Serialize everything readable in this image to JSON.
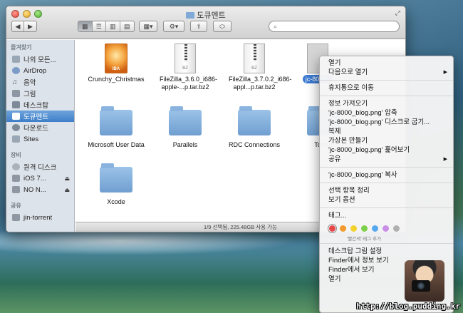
{
  "window": {
    "title": "도큐멘트"
  },
  "search": {
    "placeholder": ""
  },
  "sidebar": {
    "sections": [
      {
        "header": "즐겨찾기",
        "items": [
          "나의 모든...",
          "AirDrop",
          "음악",
          "그림",
          "데스크탑",
          "도큐멘트",
          "다운로드",
          "Sites"
        ]
      },
      {
        "header": "장비",
        "items": [
          "원격 디스크",
          "iOS 7...",
          "NO N..."
        ]
      },
      {
        "header": "공유",
        "items": [
          "jin-torrent"
        ]
      }
    ],
    "selected": "도큐멘트"
  },
  "files": {
    "row1": [
      {
        "name": "Crunchy_Christmas",
        "kind": "iba",
        "icon_label": "IBA"
      },
      {
        "name": "FileZilla_3.6.0_i686-apple-...p.tar.bz2",
        "kind": "bz2",
        "icon_label": "BZ"
      },
      {
        "name": "FileZilla_3.7.0.2_i686-appl...p.tar.bz2",
        "kind": "bz2",
        "icon_label": "BZ"
      },
      {
        "name": "jc-8000_",
        "kind": "png",
        "selected": true
      }
    ],
    "row2": [
      {
        "name": "Microsoft User Data",
        "kind": "folder"
      },
      {
        "name": "Parallels",
        "kind": "folder"
      },
      {
        "name": "RDC Connections",
        "kind": "folder"
      },
      {
        "name": "Torren",
        "kind": "folder"
      }
    ],
    "row3": [
      {
        "name": "Xcode",
        "kind": "folder"
      }
    ]
  },
  "status": {
    "text": "1/9 선택됨, 225.48GB 사용 가능"
  },
  "context_menu": {
    "groups": [
      [
        {
          "label": "열기"
        },
        {
          "label": "다음으로 열기",
          "submenu": true
        }
      ],
      [
        {
          "label": "휴지통으로 이동"
        }
      ],
      [
        {
          "label": "정보 가져오기"
        },
        {
          "label": "'jc-8000_blog.png' 압축"
        },
        {
          "label": "'jc-8000_blog.png' 디스크로 굽기..."
        },
        {
          "label": "복제"
        },
        {
          "label": "가상본 만들기"
        },
        {
          "label": "'jc-8000_blog.png' 훑어보기"
        },
        {
          "label": "공유",
          "submenu": true
        }
      ],
      [
        {
          "label": "'jc-8000_blog.png' 복사"
        }
      ],
      [
        {
          "label": "선택 항목 정리"
        },
        {
          "label": "보기 옵션"
        }
      ],
      [
        {
          "label": "태그..."
        }
      ]
    ],
    "tag_colors": [
      "#e8474a",
      "#f29a2e",
      "#f2d22e",
      "#7ed04b",
      "#58a8ee",
      "#c98ee8",
      "#b0b0b0"
    ],
    "tag_hint": "'빨간색' 태그 추가",
    "bottom_items": [
      {
        "label": "데스크탑 그림 설정"
      },
      {
        "label": "Finder에서 정보 보기"
      },
      {
        "label": "Finder에서 보기"
      },
      {
        "label": "열기"
      }
    ]
  },
  "watermark": {
    "text": "http://blog.pudding.kr"
  }
}
